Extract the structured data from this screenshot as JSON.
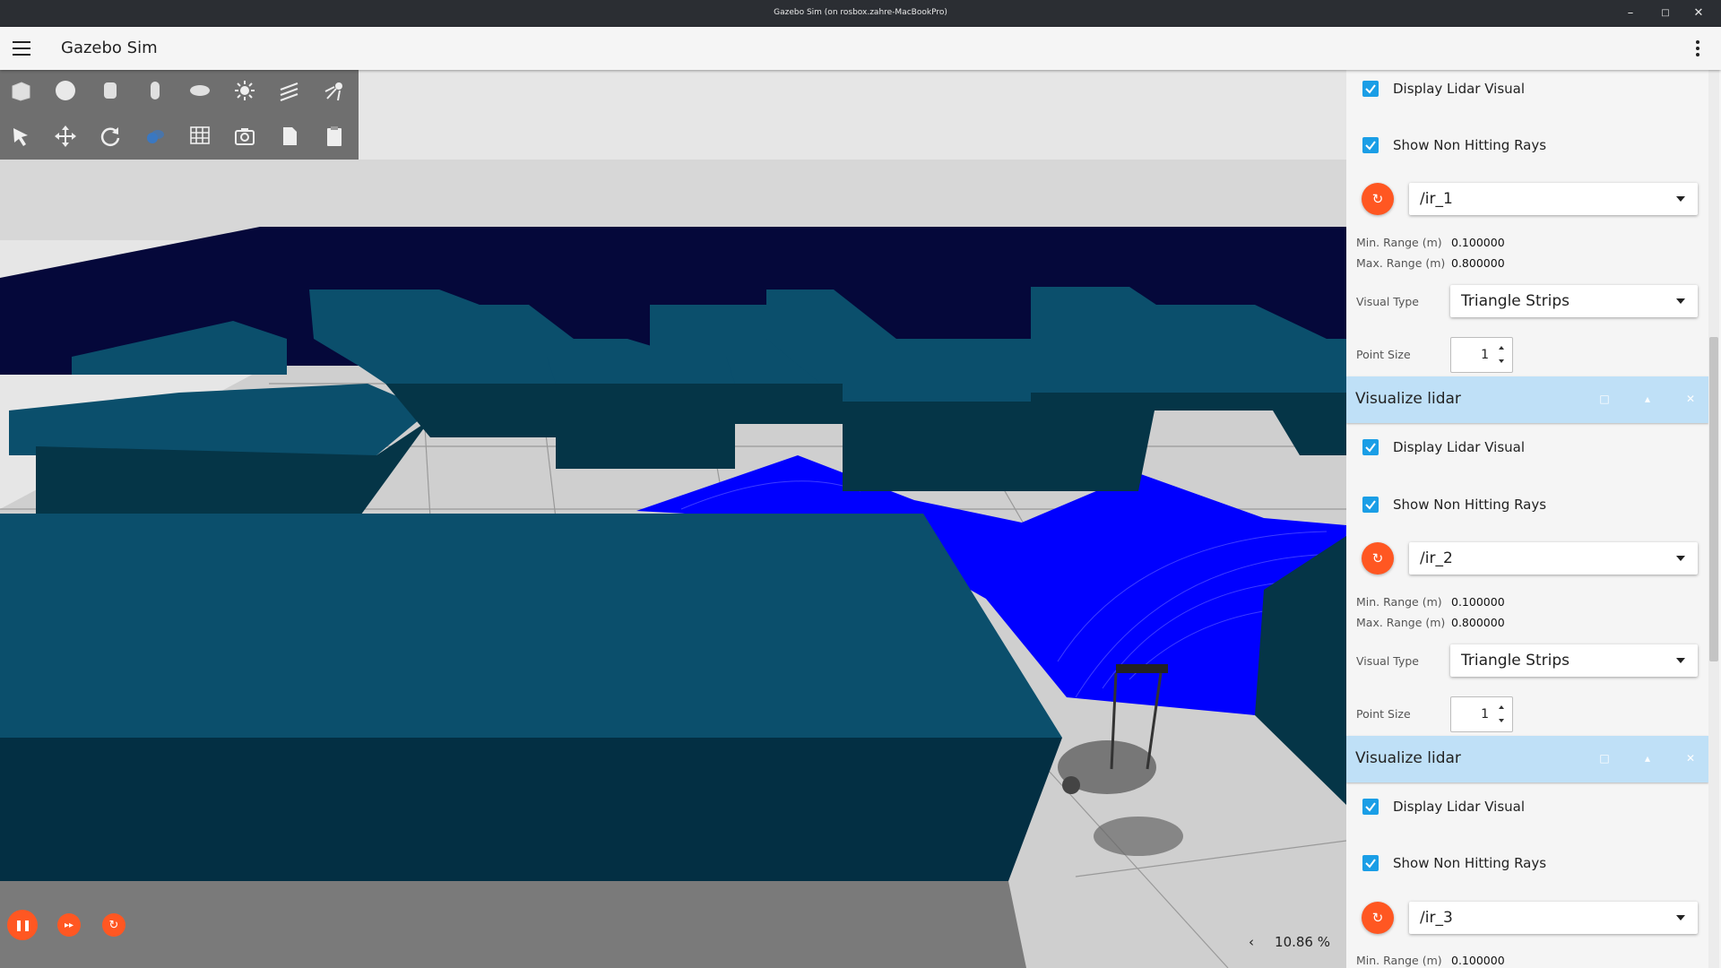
{
  "window": {
    "title": "Gazebo Sim (on rosbox.zahre-MacBookPro)",
    "minimize": "–",
    "maximize": "□",
    "close": "✕"
  },
  "appbar": {
    "title": "Gazebo Sim"
  },
  "scene": {
    "zoom_percent": "10.86 %",
    "zoom_arrow": "‹"
  },
  "controls": {
    "pause": "❚❚",
    "step": "▸▸",
    "reset": "↻"
  },
  "panel": {
    "refresh_glyph": "↻",
    "labels": {
      "display_lidar": "Display Lidar Visual",
      "show_non_hitting": "Show Non Hitting Rays",
      "min_range": "Min. Range (m)",
      "max_range": "Max. Range (m)",
      "visual_type": "Visual Type",
      "point_size": "Point Size"
    },
    "plugin_title": "Visualize lidar",
    "header_buttons": {
      "float": "□",
      "collapse": "▴",
      "close": "✕"
    },
    "sections": [
      {
        "topic": "/ir_1",
        "min_range": "0.100000",
        "max_range": "0.800000",
        "visual_type": "Triangle Strips",
        "point_size": "1",
        "display_checked": true,
        "non_hitting_checked": true
      },
      {
        "topic": "/ir_2",
        "min_range": "0.100000",
        "max_range": "0.800000",
        "visual_type": "Triangle Strips",
        "point_size": "1",
        "display_checked": true,
        "non_hitting_checked": true
      },
      {
        "topic": "/ir_3",
        "min_range": "0.100000",
        "display_checked": true,
        "non_hitting_checked": true
      }
    ]
  },
  "colors": {
    "accent": "#ff5722",
    "checkbox": "#1a9ee6",
    "header": "#bfe0f7",
    "wall": "#0b4f6c",
    "lidar": "#0000ff"
  }
}
